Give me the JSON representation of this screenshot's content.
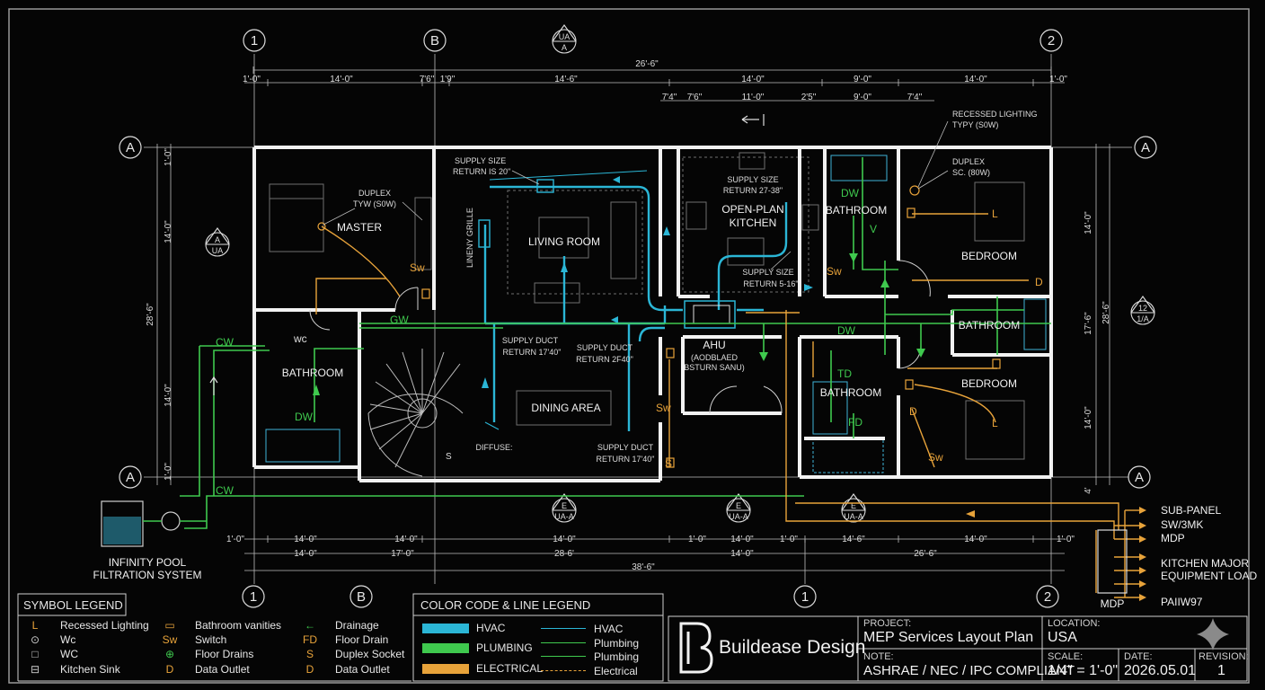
{
  "grid_bubbles": {
    "top": [
      "1",
      "B",
      "2"
    ],
    "bottom": [
      "1",
      "B",
      "1",
      "2"
    ],
    "left": [
      "A",
      "A"
    ],
    "right": [
      "A",
      "A"
    ]
  },
  "section_markers": {
    "top": {
      "top": "UA",
      "bottom": "A"
    },
    "left": {
      "top": "A",
      "bottom": "UA"
    },
    "right": {
      "top": "12",
      "bottom": "1/A"
    },
    "bottom1": {
      "top": "E",
      "bottom": "UA-A"
    },
    "bottom2": {
      "top": "E",
      "bottom": "UA-A"
    },
    "bottom3": {
      "top": "E",
      "bottom": "UA-A"
    }
  },
  "dimensions": {
    "top_overall": "26'-6\"",
    "top_row": [
      "1'-0\"",
      "14'-0\"",
      "7'6\"",
      "1'9\"",
      "14'-6\"",
      "14'-0\"",
      "9'-0\"",
      "14'-0\"",
      "1'-0\""
    ],
    "top_row2": [
      "7'4\"",
      "7'6\"",
      "11'-0\"",
      "2'5\"",
      "9'-0\"",
      "7'4\""
    ],
    "left": [
      "1'-0\"",
      "14'-0\"",
      "28'-6\"",
      "14'-0\"",
      "1'-0\""
    ],
    "right": [
      "14'-0\"",
      "17'-6\"",
      "28'-6\"",
      "14'-0\"",
      "4'"
    ],
    "bottom_row": [
      "1'-0\"",
      "14'-0\"",
      "14'-0\"",
      "14'-0\"",
      "1'-0\"",
      "14'-0\"",
      "1'-0\"",
      "14'-6\"",
      "14'-0\"",
      "1'-0\""
    ],
    "bottom_row2": [
      "14'-0\"",
      "17'-0\"",
      "28-6'",
      "14'-0\"",
      "26'-6\""
    ],
    "bottom_overall": "38'-6\""
  },
  "rooms": {
    "master": "MASTER",
    "living": "LIVING ROOM",
    "kitchen_1": "OPEN-PLAN",
    "kitchen_2": "KITCHEN",
    "bath_left": "BATHROOM",
    "bath_top": "BATHROOM",
    "bath_mid": "BATHROOM",
    "bath_right": "BATHROOM",
    "bedroom_top": "BEDROOM",
    "bedroom_bottom": "BEDROOM",
    "dining": "DINING AREA",
    "ahu": "AHU",
    "ahu_note_1": "(AODBLAED",
    "ahu_note_2": "BSTURN SANU)"
  },
  "annotations": {
    "duplex_master_1": "DUPLEX",
    "duplex_master_2": "TYW (S0W)",
    "supply_living_1": "SUPPLY SIZE",
    "supply_living_2": "RETURN IS 20\"",
    "linen_grille": "LINENY GRILLE",
    "supply_kitchen_1": "SUPPLY SIZE",
    "supply_kitchen_2": "RETURN 27-38\"",
    "supply_kitchen2_1": "SUPPLY SIZE",
    "supply_kitchen2_2": "RETURN 5-16\"",
    "recessed_1": "RECESSED LIGHTING",
    "recessed_2": "TYPY (S0W)",
    "duplex_right_1": "DUPLEX",
    "duplex_right_2": "SC. (80W)",
    "supply_duct_a1": "SUPPLY DUCT",
    "supply_duct_a2": "RETURN 17'40\"",
    "supply_duct_b1": "SUPPLY DUCT",
    "supply_duct_b2": "RETURN 2F40\"",
    "supply_duct_c1": "SUPPLY DUCT",
    "supply_duct_c2": "RETURN 17'40\"",
    "diffuser": "DIFFUSE:",
    "pool_1": "INFINITY POOL",
    "pool_2": "FILTRATION SYSTEM"
  },
  "tags": {
    "cw1": "CW",
    "cw2": "CW",
    "gw": "GW",
    "wc": "wc",
    "dw_left": "DW",
    "dw_top": "DW",
    "dw_mid": "DW",
    "v": "V",
    "l1": "L",
    "l2": "L",
    "d1": "D",
    "d2": "D",
    "sw1": "Sw",
    "sw2": "Sw",
    "sw3": "Sw",
    "sw4": "Sw",
    "fd": "FD",
    "td": "TD",
    "s_stair": "S",
    "s_dining": "S"
  },
  "panel": {
    "label": "MDP",
    "feeds": [
      "SUB-PANEL",
      "SW/3MK",
      "MDP",
      "KITCHEN MAJOR",
      "EQUIPMENT LOAD",
      "PAIIW97"
    ]
  },
  "symbol_legend": {
    "title": "SYMBOL LEGEND",
    "items": [
      {
        "sym": "L",
        "label": "Recessed Lighting",
        "color": "#e8a33a"
      },
      {
        "sym": "⊙",
        "label": "Wc",
        "color": "#cccccc"
      },
      {
        "sym": "□",
        "label": "WC",
        "color": "#cccccc"
      },
      {
        "sym": "⊟",
        "label": "Kitchen Sink",
        "color": "#cccccc"
      },
      {
        "sym": "▭",
        "label": "Bathroom vanities",
        "color": "#e8a33a"
      },
      {
        "sym": "Sw",
        "label": "Switch",
        "color": "#e8a33a"
      },
      {
        "sym": "⊕",
        "label": "Floor Drains",
        "color": "#3fc94e"
      },
      {
        "sym": "D",
        "label": "Data Outlet",
        "color": "#e8a33a"
      },
      {
        "sym": "←",
        "label": "Drainage",
        "color": "#3fc94e"
      },
      {
        "sym": "FD",
        "label": "Floor Drain",
        "color": "#e8a33a"
      },
      {
        "sym": "S",
        "label": "Duplex Socket",
        "color": "#e8a33a"
      },
      {
        "sym": "D",
        "label": "Data Outlet",
        "color": "#e8a33a"
      }
    ]
  },
  "color_legend": {
    "title": "COLOR CODE & LINE LEGEND",
    "swatches": [
      {
        "label": "HVAC",
        "color": "#2bb6d6"
      },
      {
        "label": "PLUMBING",
        "color": "#3fc94e"
      },
      {
        "label": "ELECTRICAL",
        "color": "#e8a33a"
      }
    ],
    "lines": [
      {
        "label": "HVAC",
        "color": "#2bb6d6"
      },
      {
        "label": "Plumbing",
        "color": "#3fc94e"
      },
      {
        "label": "Plumbing",
        "color": "#3fc94e"
      },
      {
        "label": "Electrical",
        "color": "#e8a33a"
      }
    ]
  },
  "title_block": {
    "company": "Buildease Design",
    "project_label": "PROJECT:",
    "project": "MEP Services Layout Plan",
    "location_label": "LOCATION:",
    "location": "USA",
    "note_label": "NOTE:",
    "note": "ASHRAE / NEC / IPC COMPLIANT",
    "scale_label": "SCALE:",
    "scale": "1/4\" = 1'-0\"",
    "date_label": "DATE:",
    "date": "2026.05.01",
    "revision_label": "REVISION:",
    "revision": "1"
  },
  "colors": {
    "hvac": "#2bb6d6",
    "plumbing": "#3fc94e",
    "electrical": "#e8a33a",
    "wall": "#f2f2f2",
    "background": "#050505"
  }
}
